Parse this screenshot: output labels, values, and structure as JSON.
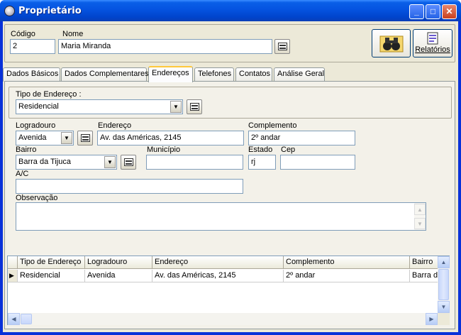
{
  "window": {
    "title": "Proprietário",
    "minimize_glyph": "_",
    "maximize_glyph": "□",
    "close_glyph": "✕"
  },
  "header": {
    "codigo_label": "Código",
    "codigo_value": "2",
    "nome_label": "Nome",
    "nome_value": "Maria Miranda",
    "relatorios_label": "Relatórios"
  },
  "tabs": [
    {
      "label": "Dados Básicos"
    },
    {
      "label": "Dados Complementares"
    },
    {
      "label": "Endereços",
      "active": true
    },
    {
      "label": "Telefones"
    },
    {
      "label": "Contatos"
    },
    {
      "label": "Análise Geral"
    }
  ],
  "form": {
    "tipo_label": "Tipo de Endereço :",
    "tipo_value": "Residencial",
    "logradouro_label": "Logradouro",
    "logradouro_value": "Avenida",
    "endereco_label": "Endereço",
    "endereco_value": "Av. das Américas, 2145",
    "complemento_label": "Complemento",
    "complemento_value": "2º andar",
    "bairro_label": "Bairro",
    "bairro_value": "Barra da Tijuca",
    "municipio_label": "Município",
    "municipio_value": "",
    "estado_label": "Estado",
    "estado_value": "rj",
    "cep_label": "Cep",
    "cep_value": "",
    "ac_label": "A/C",
    "ac_value": "",
    "observacao_label": "Observação",
    "observacao_value": ""
  },
  "grid": {
    "columns": [
      "Tipo de Endereço",
      "Logradouro",
      "Endereço",
      "Complemento",
      "Bairro"
    ],
    "rows": [
      [
        "Residencial",
        "Avenida",
        "Av. das Américas, 2145",
        "2º andar",
        "Barra d"
      ]
    ],
    "row_indicator": "▶"
  },
  "colors": {
    "title_bar": "#0553e0",
    "face": "#ece9d8",
    "active_tab_accent": "#ffc83c"
  }
}
